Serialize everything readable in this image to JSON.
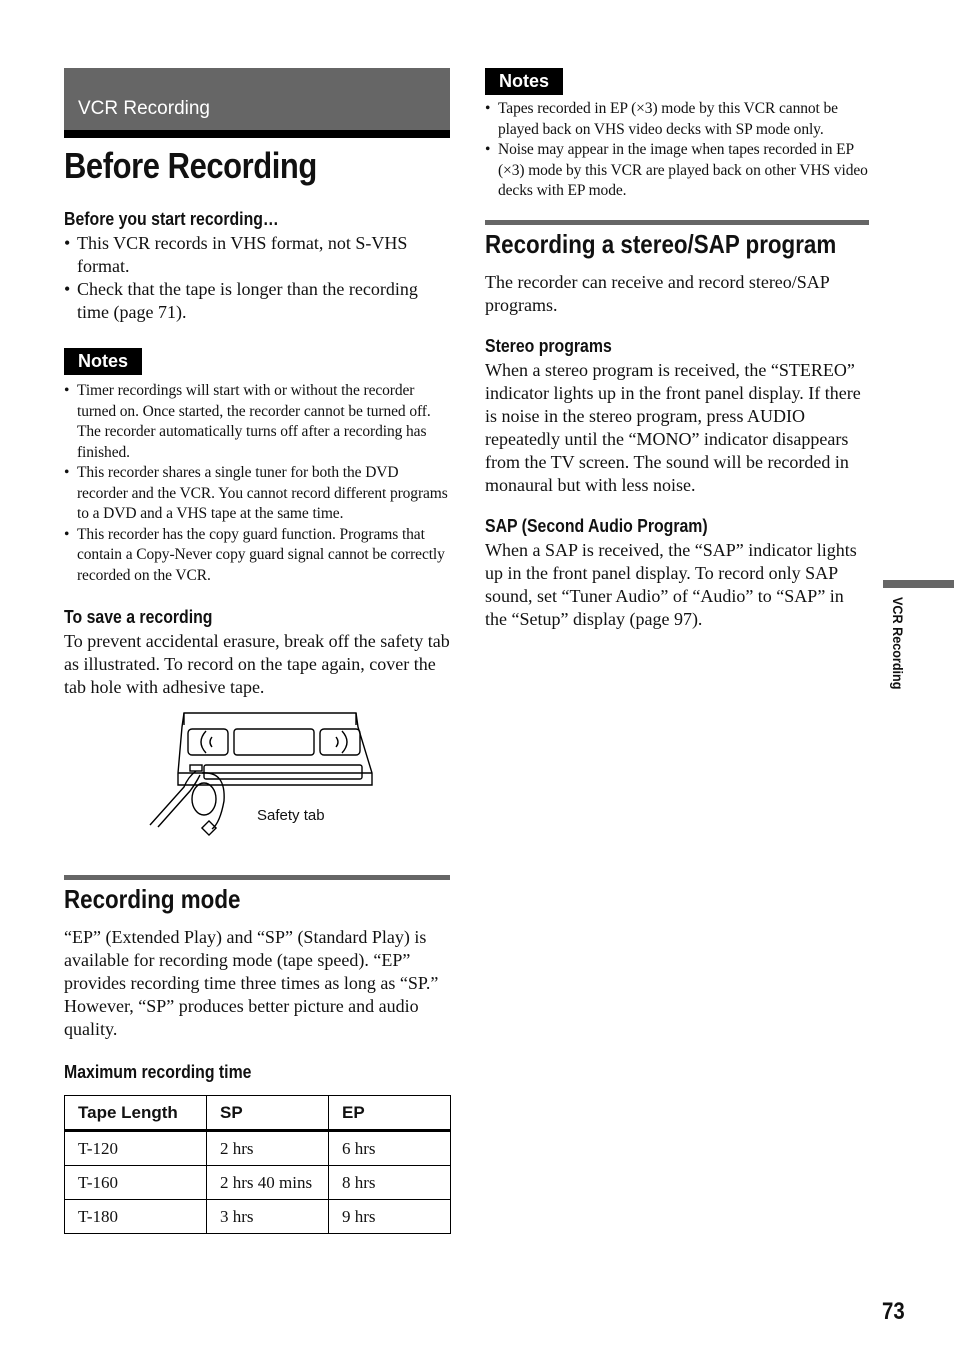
{
  "chapter": {
    "title": "VCR Recording"
  },
  "page_title": "Before Recording",
  "before_start": {
    "heading": "Before you start recording…",
    "bullets": [
      "This VCR records in VHS format, not S-VHS format.",
      "Check that the tape is longer than the recording time (page 71)."
    ]
  },
  "notes_left": {
    "badge": "Notes",
    "items": [
      "Timer recordings will start with or without the recorder turned on. Once started, the recorder cannot be turned off. The recorder automatically turns off after a recording has finished.",
      "This recorder shares a single tuner for both the DVD recorder and the VCR. You cannot record different programs to a DVD and a VHS tape at the same time.",
      "This recorder has the copy guard function. Programs that contain a Copy-Never copy guard signal cannot be correctly recorded on the VCR."
    ]
  },
  "save_recording": {
    "heading": "To save a recording",
    "text": "To prevent accidental erasure, break off the safety tab as illustrated. To record on the tape again, cover the tab hole with adhesive tape.",
    "illustration_caption": "Safety tab",
    "illustration_icon": "vhs-cassette-icon"
  },
  "recording_mode": {
    "heading": "Recording mode",
    "text": "“EP” (Extended Play) and “SP” (Standard Play) is available for recording mode (tape speed). “EP” provides recording time three times as long as “SP.” However, “SP” produces better picture and audio quality.",
    "table_heading": "Maximum recording time",
    "table": {
      "columns": [
        "Tape Length",
        "SP",
        "EP"
      ],
      "rows": [
        [
          "T-120",
          "2 hrs",
          "6 hrs"
        ],
        [
          "T-160",
          "2 hrs 40 mins",
          "8 hrs"
        ],
        [
          "T-180",
          "3 hrs",
          "9 hrs"
        ]
      ]
    }
  },
  "notes_right": {
    "badge": "Notes",
    "items": [
      "Tapes recorded in EP (×3) mode by this VCR cannot be played back on VHS video decks with SP mode only.",
      "Noise may appear in the image when tapes recorded in EP (×3) mode by this VCR are played back on other VHS video decks with EP mode."
    ]
  },
  "stereo_sap": {
    "heading": "Recording a stereo/SAP program",
    "intro": "The recorder can receive and record stereo/SAP programs.",
    "stereo_heading": "Stereo programs",
    "stereo_text": "When a stereo program is received, the “STEREO” indicator lights up in the front panel display. If there is noise in the stereo program, press AUDIO repeatedly until the “MONO” indicator disappears from the TV screen. The sound will be recorded in monaural but with less noise.",
    "sap_heading": "SAP (Second Audio Program)",
    "sap_text": "When a SAP is received, the “SAP” indicator lights up in the front panel display. To record only SAP sound, set “Tuner Audio” of “Audio” to “SAP” in the “Setup” display (page 97)."
  },
  "side_tab": {
    "label": "VCR Recording"
  },
  "page_number": "73",
  "colors": {
    "band_gray": "#666666",
    "rule_black": "#000000",
    "text": "#111111"
  }
}
